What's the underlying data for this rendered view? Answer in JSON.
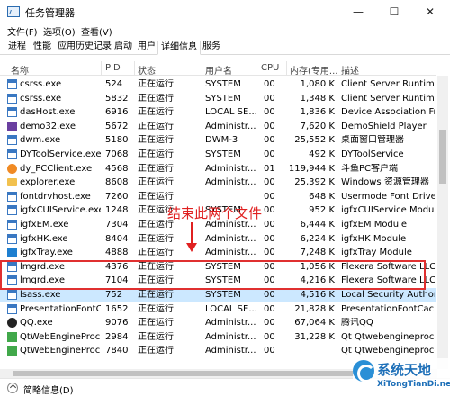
{
  "window": {
    "title": "任务管理器",
    "minimize": "—",
    "maximize": "☐",
    "close": "✕"
  },
  "menu": [
    {
      "label": "文件(F)"
    },
    {
      "label": "选项(O)"
    },
    {
      "label": "查看(V)"
    }
  ],
  "tabs": [
    {
      "label": "进程"
    },
    {
      "label": "性能"
    },
    {
      "label": "应用历史记录"
    },
    {
      "label": "启动"
    },
    {
      "label": "用户"
    },
    {
      "label": "详细信息"
    },
    {
      "label": "服务"
    }
  ],
  "active_tab": "详细信息",
  "columns": {
    "name": "名称",
    "pid": "PID",
    "status": "状态",
    "user": "用户名",
    "cpu": "CPU",
    "memory": "内存(专用...",
    "desc": "描述"
  },
  "processes": [
    {
      "name": "csrss.exe",
      "pid": "524",
      "status": "正在运行",
      "user": "SYSTEM",
      "cpu": "00",
      "memory": "1,080 K",
      "desc": "Client Server Runtime ...",
      "icon": "generic-process-icon",
      "icon_color": "#3a78c2"
    },
    {
      "name": "csrss.exe",
      "pid": "5832",
      "status": "正在运行",
      "user": "SYSTEM",
      "cpu": "00",
      "memory": "1,348 K",
      "desc": "Client Server Runtime ...",
      "icon": "generic-process-icon",
      "icon_color": "#3a78c2"
    },
    {
      "name": "dasHost.exe",
      "pid": "6916",
      "status": "正在运行",
      "user": "LOCAL SE...",
      "cpu": "00",
      "memory": "1,836 K",
      "desc": "Device Association Fr...",
      "icon": "generic-process-icon",
      "icon_color": "#3a78c2"
    },
    {
      "name": "demo32.exe",
      "pid": "5672",
      "status": "正在运行",
      "user": "Administr...",
      "cpu": "00",
      "memory": "7,620 K",
      "desc": "DemoShield Player",
      "icon": "demo-icon",
      "icon_color": "#6a3fa0"
    },
    {
      "name": "dwm.exe",
      "pid": "5180",
      "status": "正在运行",
      "user": "DWM-3",
      "cpu": "00",
      "memory": "25,552 K",
      "desc": "桌面窗口管理器",
      "icon": "generic-process-icon",
      "icon_color": "#3a78c2"
    },
    {
      "name": "DYToolService.exe",
      "pid": "7068",
      "status": "正在运行",
      "user": "SYSTEM",
      "cpu": "00",
      "memory": "492 K",
      "desc": "DYToolService",
      "icon": "generic-process-icon",
      "icon_color": "#3a78c2"
    },
    {
      "name": "dy_PCClient.exe",
      "pid": "4568",
      "status": "正在运行",
      "user": "Administr...",
      "cpu": "01",
      "memory": "119,944 K",
      "desc": "斗鱼PC客户端",
      "icon": "douyu-icon",
      "icon_color": "#f08a24"
    },
    {
      "name": "explorer.exe",
      "pid": "8608",
      "status": "正在运行",
      "user": "Administr...",
      "cpu": "00",
      "memory": "25,392 K",
      "desc": "Windows 资源管理器",
      "icon": "folder-icon",
      "icon_color": "#f2c14e"
    },
    {
      "name": "fontdrvhost.exe",
      "pid": "7260",
      "status": "正在运行",
      "user": "",
      "cpu": "00",
      "memory": "648 K",
      "desc": "Usermode Font Drive...",
      "icon": "generic-process-icon",
      "icon_color": "#3a78c2"
    },
    {
      "name": "igfxCUIService.exe",
      "pid": "1248",
      "status": "正在运行",
      "user": "SYSTEM",
      "cpu": "00",
      "memory": "952 K",
      "desc": "igfxCUIService Module",
      "icon": "generic-process-icon",
      "icon_color": "#3a78c2"
    },
    {
      "name": "igfxEM.exe",
      "pid": "7304",
      "status": "正在运行",
      "user": "Administr...",
      "cpu": "00",
      "memory": "6,444 K",
      "desc": "igfxEM Module",
      "icon": "generic-process-icon",
      "icon_color": "#3a78c2"
    },
    {
      "name": "igfxHK.exe",
      "pid": "8404",
      "status": "正在运行",
      "user": "Administr...",
      "cpu": "00",
      "memory": "6,224 K",
      "desc": "igfxHK Module",
      "icon": "generic-process-icon",
      "icon_color": "#3a78c2"
    },
    {
      "name": "igfxTray.exe",
      "pid": "4888",
      "status": "正在运行",
      "user": "Administr...",
      "cpu": "00",
      "memory": "7,248 K",
      "desc": "igfxTray Module",
      "icon": "intel-tray-icon",
      "icon_color": "#1e7fd0"
    },
    {
      "name": "lmgrd.exe",
      "pid": "4376",
      "status": "正在运行",
      "user": "SYSTEM",
      "cpu": "00",
      "memory": "1,056 K",
      "desc": "Flexera Software LLC.",
      "icon": "generic-process-icon",
      "icon_color": "#3a78c2"
    },
    {
      "name": "lmgrd.exe",
      "pid": "7104",
      "status": "正在运行",
      "user": "SYSTEM",
      "cpu": "00",
      "memory": "4,216 K",
      "desc": "Flexera Software LLC.",
      "icon": "generic-process-icon",
      "icon_color": "#3a78c2"
    },
    {
      "name": "lsass.exe",
      "pid": "752",
      "status": "正在运行",
      "user": "SYSTEM",
      "cpu": "00",
      "memory": "4,516 K",
      "desc": "Local Security Authori...",
      "icon": "generic-process-icon",
      "icon_color": "#3a78c2",
      "selected": true
    },
    {
      "name": "PresentationFontC...",
      "pid": "1652",
      "status": "正在运行",
      "user": "LOCAL SE...",
      "cpu": "00",
      "memory": "21,828 K",
      "desc": "PresentationFontCach...",
      "icon": "generic-process-icon",
      "icon_color": "#3a78c2"
    },
    {
      "name": "QQ.exe",
      "pid": "9076",
      "status": "正在运行",
      "user": "Administr...",
      "cpu": "00",
      "memory": "67,064 K",
      "desc": "腾讯QQ",
      "icon": "qq-icon",
      "icon_color": "#222222"
    },
    {
      "name": "QtWebEngineProc...",
      "pid": "2984",
      "status": "正在运行",
      "user": "Administr...",
      "cpu": "00",
      "memory": "31,228 K",
      "desc": "Qt Qtwebengineproce...",
      "icon": "qt-icon",
      "icon_color": "#41a84a"
    },
    {
      "name": "QtWebEngineProc...",
      "pid": "7840",
      "status": "正在运行",
      "user": "Administr...",
      "cpu": "00",
      "memory": "",
      "desc": "Qt Qtwebengineproce...",
      "icon": "qt-icon",
      "icon_color": "#41a84a"
    }
  ],
  "annotation": {
    "text": "结束此两个文件",
    "color": "#e02020"
  },
  "footer": {
    "label": "简略信息(D)"
  },
  "watermark": {
    "title": "系统天地",
    "url": "XiTongTianDi.net"
  },
  "colors": {
    "selection": "#cce8ff",
    "highlight_box": "#e03030"
  }
}
